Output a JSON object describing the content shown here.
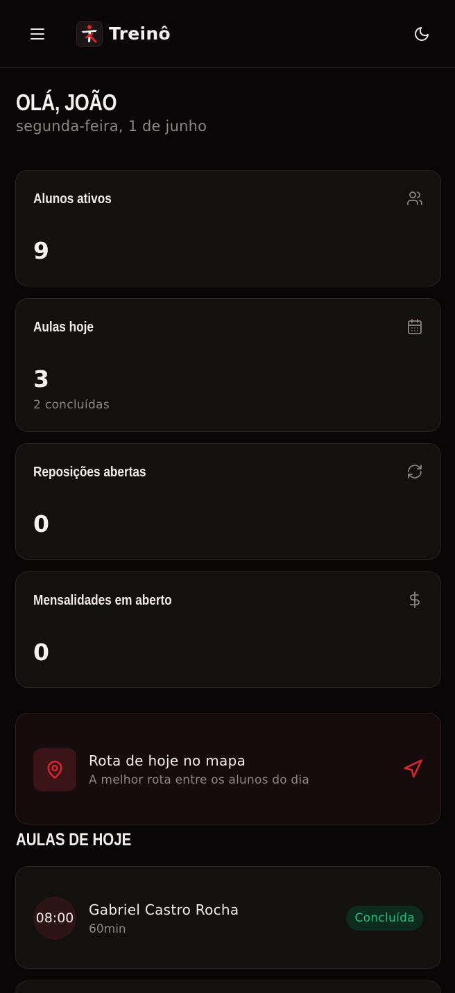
{
  "header": {
    "app_name": "Treinô",
    "menu_icon": "menu-icon",
    "theme_icon": "moon-icon",
    "logo_icon": "treino-logo"
  },
  "greeting": {
    "title": "OLÁ, JOÃO",
    "date": "segunda-feira, 1 de junho"
  },
  "stats": [
    {
      "title": "Alunos ativos",
      "value": "9",
      "subtitle": "",
      "icon": "users-icon"
    },
    {
      "title": "Aulas hoje",
      "value": "3",
      "subtitle": "2 concluídas",
      "icon": "calendar-icon"
    },
    {
      "title": "Reposições abertas",
      "value": "0",
      "subtitle": "",
      "icon": "refresh-icon"
    },
    {
      "title": "Mensalidades em aberto",
      "value": "0",
      "subtitle": "",
      "icon": "dollar-icon"
    }
  ],
  "route": {
    "title": "Rota de hoje no mapa",
    "subtitle": "A melhor rota entre os alunos do dia",
    "icon": "map-pin-icon",
    "action_icon": "navigation-icon"
  },
  "classes_section": {
    "title": "AULAS DE HOJE",
    "items": [
      {
        "time": "08:00",
        "student": "Gabriel Castro Rocha",
        "duration": "60min",
        "status": "Concluída"
      }
    ]
  },
  "colors": {
    "background": "#080606",
    "card": "#131010",
    "accent": "#e0262f",
    "success": "#22c27a",
    "muted": "#8d8585"
  }
}
